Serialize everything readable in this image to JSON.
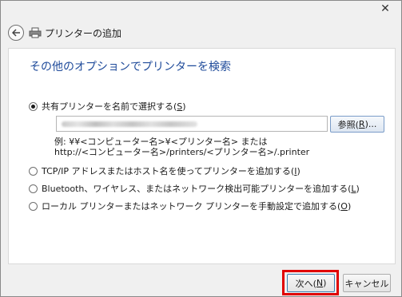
{
  "window": {
    "close_glyph": "✕",
    "title": "プリンターの追加"
  },
  "content": {
    "heading": "その他のオプションでプリンターを検索",
    "options": [
      {
        "label_prefix": "共有プリンターを名前で選択する(",
        "key": "S",
        "label_suffix": ")",
        "checked": true
      },
      {
        "label_prefix": "TCP/IP アドレスまたはホスト名を使ってプリンターを追加する(",
        "key": "I",
        "label_suffix": ")",
        "checked": false
      },
      {
        "label_prefix": "Bluetooth、ワイヤレス、またはネットワーク検出可能プリンターを追加する(",
        "key": "L",
        "label_suffix": ")",
        "checked": false
      },
      {
        "label_prefix": "ローカル プリンターまたはネットワーク プリンターを手動設定で追加する(",
        "key": "O",
        "label_suffix": ")",
        "checked": false
      }
    ],
    "path_input_value": "",
    "browse_button": {
      "prefix": "参照(",
      "key": "R",
      "suffix": ")..."
    },
    "example_line1": "例: ¥¥<コンピューター名>¥<プリンター名> または",
    "example_line2": "http://<コンピューター名>/printers/<プリンター名>/.printer"
  },
  "footer": {
    "next_button": {
      "prefix": "次へ(",
      "key": "N",
      "suffix": ")"
    },
    "cancel_button": "キャンセル"
  },
  "colors": {
    "heading": "#1e4a9a",
    "highlight": "#e00000"
  }
}
